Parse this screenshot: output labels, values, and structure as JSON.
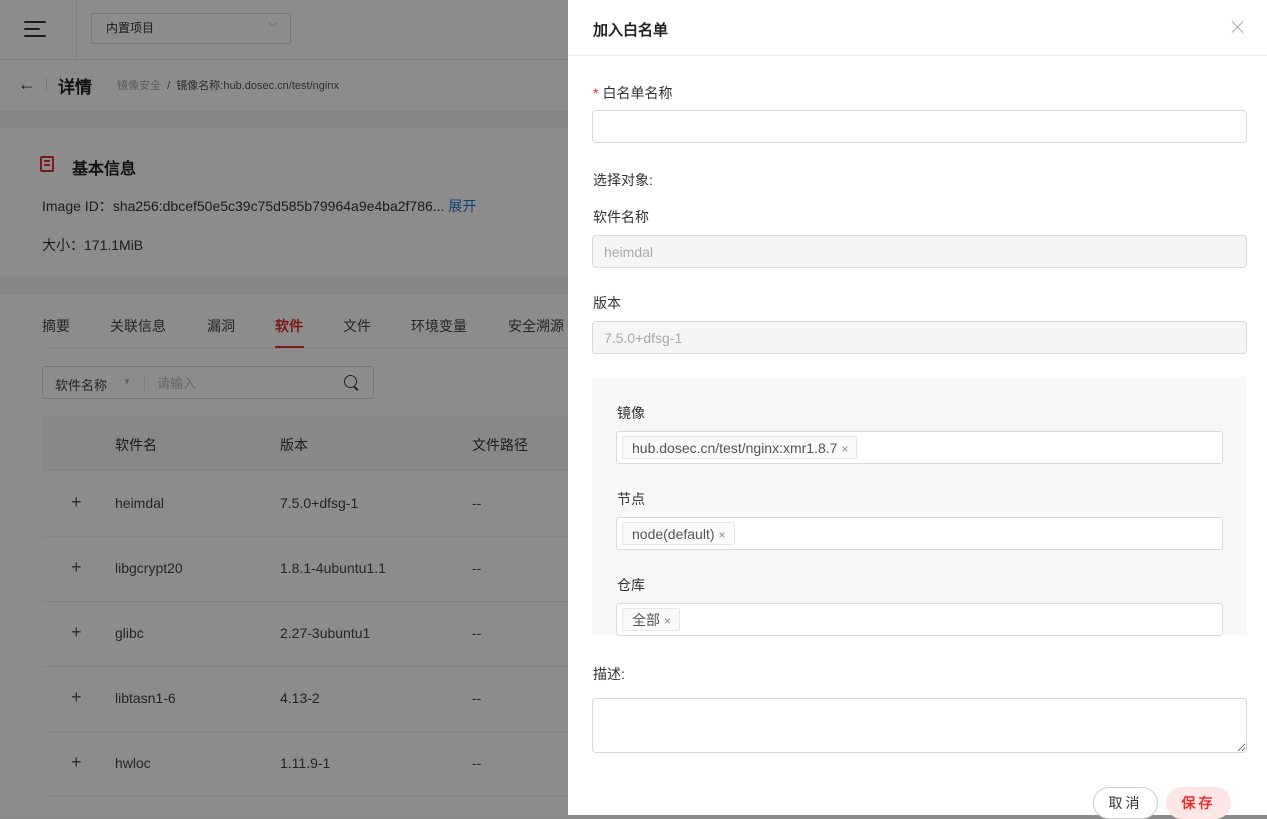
{
  "topbar": {
    "project": "内置项目"
  },
  "breadcrumb": {
    "back": "←",
    "title": "详情",
    "parent": "镜像安全",
    "sep": "/",
    "current": "镜像名称:hub.dosec.cn/test/nginx"
  },
  "info": {
    "title": "基本信息",
    "image_id_label": "Image ID：",
    "image_id_value": "sha256:dbcef50e5c39c75d585b79964a9e4ba2f786...",
    "expand": "展开",
    "size_label": "大小：",
    "size_value": "171.1MiB"
  },
  "tabs": [
    "摘要",
    "关联信息",
    "漏洞",
    "软件",
    "文件",
    "环境变量",
    "安全溯源"
  ],
  "active_tab": "软件",
  "search": {
    "field": "软件名称",
    "placeholder": "请输入"
  },
  "table": {
    "headers": [
      "软件名",
      "版本",
      "文件路径"
    ],
    "rows": [
      {
        "name": "heimdal",
        "version": "7.5.0+dfsg-1",
        "path": "--"
      },
      {
        "name": "libgcrypt20",
        "version": "1.8.1-4ubuntu1.1",
        "path": "--"
      },
      {
        "name": "glibc",
        "version": "2.27-3ubuntu1",
        "path": "--"
      },
      {
        "name": "libtasn1-6",
        "version": "4.13-2",
        "path": "--"
      },
      {
        "name": "hwloc",
        "version": "1.11.9-1",
        "path": "--"
      }
    ]
  },
  "drawer": {
    "title": "加入白名单",
    "required_mark": "*",
    "name_label": "白名单名称",
    "name_value": "",
    "select_target": "选择对象:",
    "software_label": "软件名称",
    "software_value": "heimdal",
    "version_label": "版本",
    "version_value": "7.5.0+dfsg-1",
    "image_label": "镜像",
    "image_tag": "hub.dosec.cn/test/nginx:xmr1.8.7",
    "node_label": "节点",
    "node_tag": "node(default)",
    "repo_label": "仓库",
    "repo_tag": "全部",
    "tag_remove": "×",
    "desc_label": "描述:",
    "desc_value": "",
    "cancel": "取消",
    "save": "保存"
  },
  "colors": {
    "accent": "#e0312d",
    "link": "#2a6fd6",
    "overlay": "rgba(0,0,0,0.45)"
  }
}
